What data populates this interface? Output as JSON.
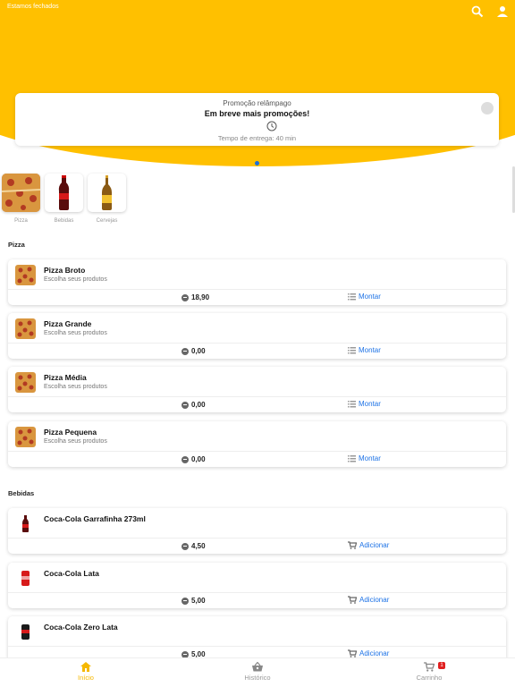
{
  "header": {
    "status_text": "Estamos fechados",
    "icons": [
      "search-icon",
      "user-icon"
    ],
    "brand_color": "#ffc000"
  },
  "promo": {
    "label": "Promoção relâmpago",
    "title": "Em breve mais promoções!",
    "delivery": "Tempo de entrega: 40 min"
  },
  "categories": [
    {
      "label": "Pizza"
    },
    {
      "label": "Bebidas"
    },
    {
      "label": "Cervejas"
    }
  ],
  "sections": {
    "pizza_title": "Pizza",
    "bebidas_title": "Bebidas"
  },
  "pizzas": [
    {
      "name": "Pizza Broto",
      "desc": "Escolha seus produtos",
      "price": "18,90",
      "action": "Montar"
    },
    {
      "name": "Pizza Grande",
      "desc": "Escolha seus produtos",
      "price": "0,00",
      "action": "Montar"
    },
    {
      "name": "Pizza Média",
      "desc": "Escolha seus produtos",
      "price": "0,00",
      "action": "Montar"
    },
    {
      "name": "Pizza Pequena",
      "desc": "Escolha seus produtos",
      "price": "0,00",
      "action": "Montar"
    }
  ],
  "bebidas": [
    {
      "name": "Coca-Cola Garrafinha 273ml",
      "price": "4,50",
      "action": "Adicionar"
    },
    {
      "name": "Coca-Cola Lata",
      "price": "5,00",
      "action": "Adicionar"
    },
    {
      "name": "Coca-Cola Zero Lata",
      "price": "5,00",
      "action": "Adicionar"
    }
  ],
  "nav": {
    "home": "Início",
    "history": "Histórico",
    "cart": "Carrinho",
    "cart_count": "1",
    "active_color": "#f5b800",
    "link_color": "#1e73e6"
  }
}
